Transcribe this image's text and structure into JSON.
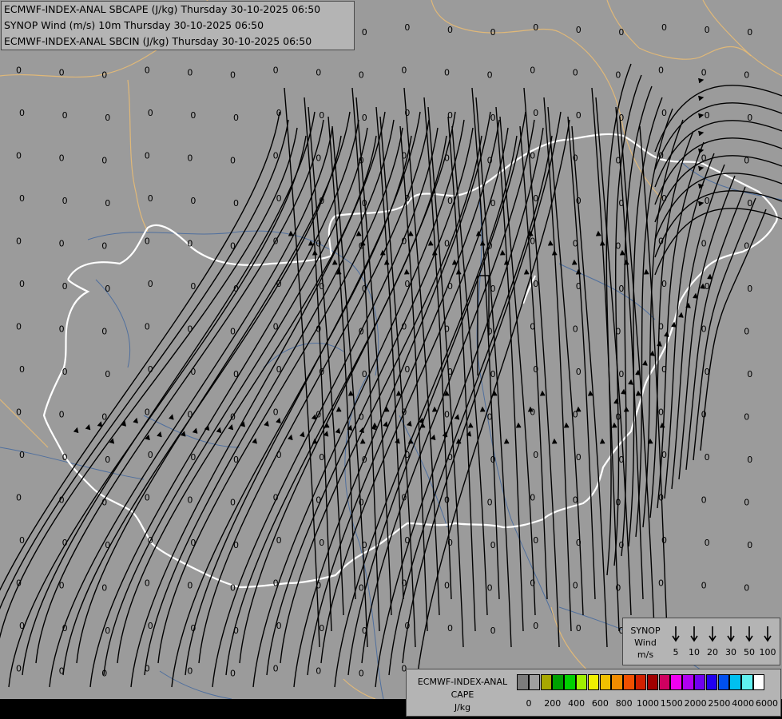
{
  "title_lines": [
    "ECMWF-INDEX-ANAL SBCAPE (J/kg) Thursday 30-10-2025 06:50",
    "SYNOP Wind (m/s) 10m Thursday 30-10-2025 06:50",
    "ECMWF-INDEX-ANAL SBCIN (J/kg) Thursday 30-10-2025 06:50"
  ],
  "wind_legend": {
    "label_lines": [
      "SYNOP",
      "Wind",
      "m/s"
    ],
    "values": [
      "5",
      "10",
      "20",
      "30",
      "50",
      "100"
    ]
  },
  "cape_legend": {
    "label_lines": [
      "ECMWF-INDEX-ANAL",
      "CAPE",
      "J/kg"
    ],
    "ticks": [
      "0",
      "200",
      "400",
      "600",
      "800",
      "1000",
      "1500",
      "2000",
      "2500",
      "4000",
      "6000"
    ],
    "colors": [
      "#7c7c7c",
      "#a0a0a0",
      "#a8a800",
      "#00a000",
      "#00d000",
      "#a0f000",
      "#f0f000",
      "#f0c000",
      "#f08c00",
      "#f05000",
      "#d02000",
      "#a00000",
      "#d00060",
      "#f000f0",
      "#b000f0",
      "#7000f0",
      "#2000f0",
      "#0050f0",
      "#00c0f0",
      "#60f0f0",
      "#ffffff"
    ]
  },
  "map": {
    "background": "#9b9b9b",
    "field_value": "0",
    "border_color": "#e0b878",
    "country_border_color": "#ffffff",
    "river_color": "#4f6f9e",
    "streamline_color": "#000000"
  }
}
